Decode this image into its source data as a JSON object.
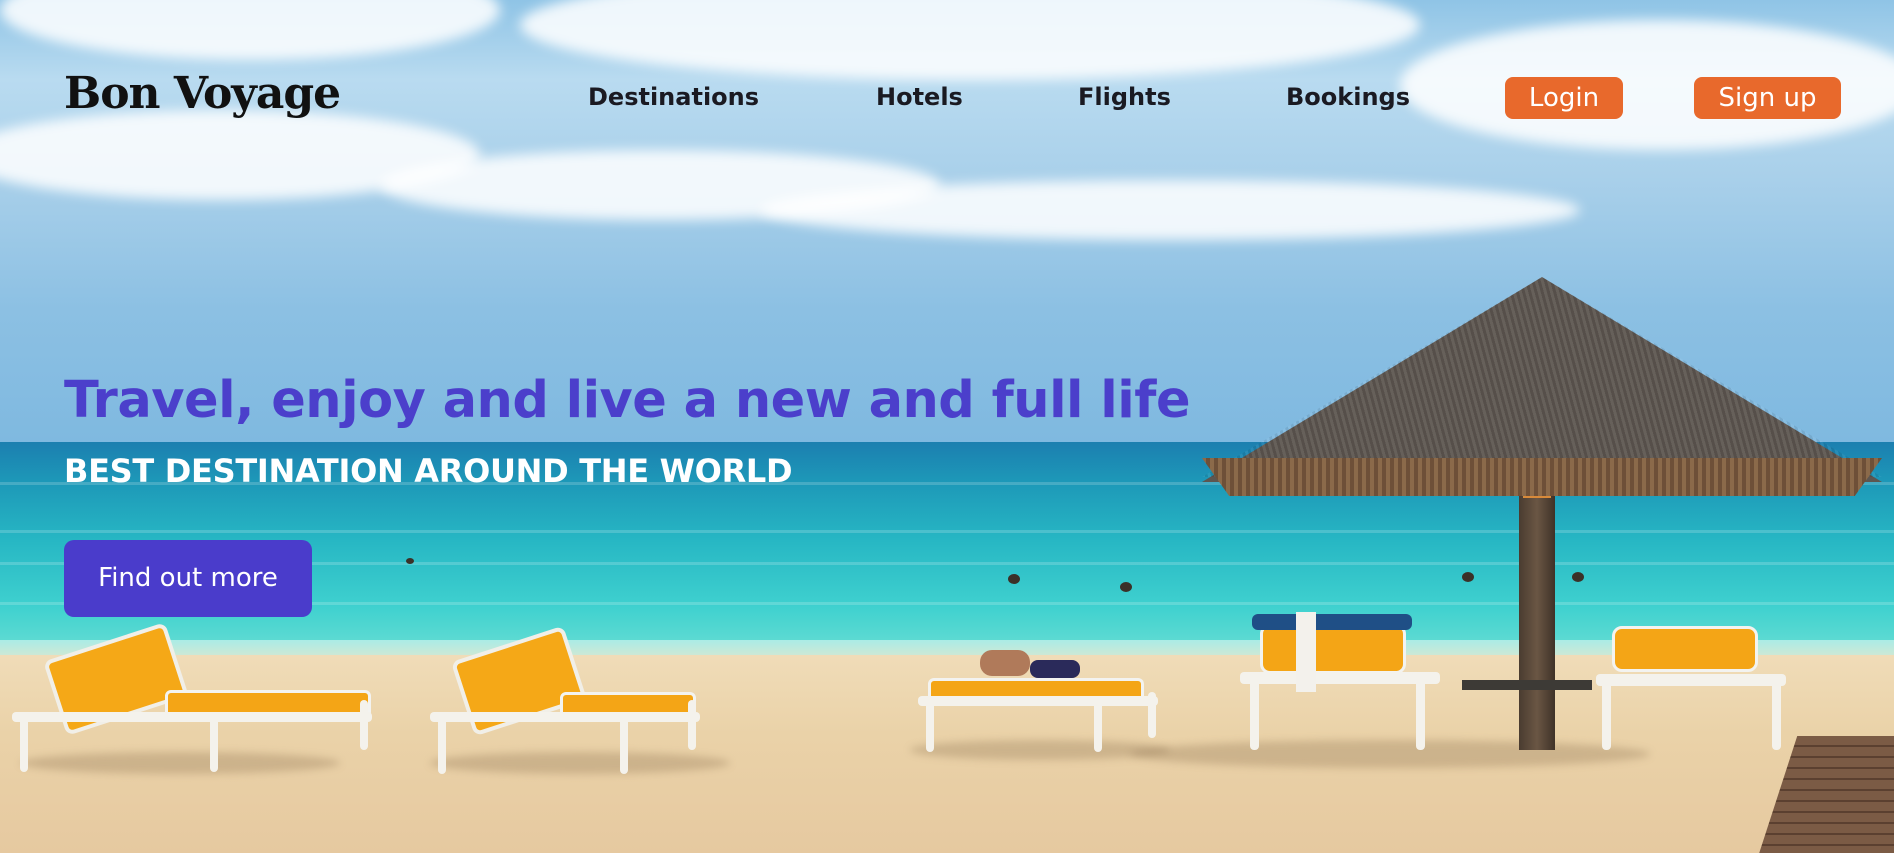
{
  "brand": {
    "logo_text": "Bon Voyage"
  },
  "nav": {
    "links": [
      {
        "label": "Destinations"
      },
      {
        "label": "Hotels"
      },
      {
        "label": "Flights"
      },
      {
        "label": "Bookings"
      }
    ],
    "login_label": "Login",
    "signup_label": "Sign up"
  },
  "hero": {
    "title": "Travel, enjoy and live a new and full life",
    "subtitle": "BEST DESTINATION AROUND THE WORLD",
    "cta_label": "Find out more"
  },
  "colors": {
    "accent_orange": "#e8692c",
    "primary_purple": "#4a3ccb",
    "heading_purple": "#4b3fcb"
  },
  "background": {
    "image_subject": "tropical-beach-with-lounge-chairs-and-thatched-umbrella"
  }
}
